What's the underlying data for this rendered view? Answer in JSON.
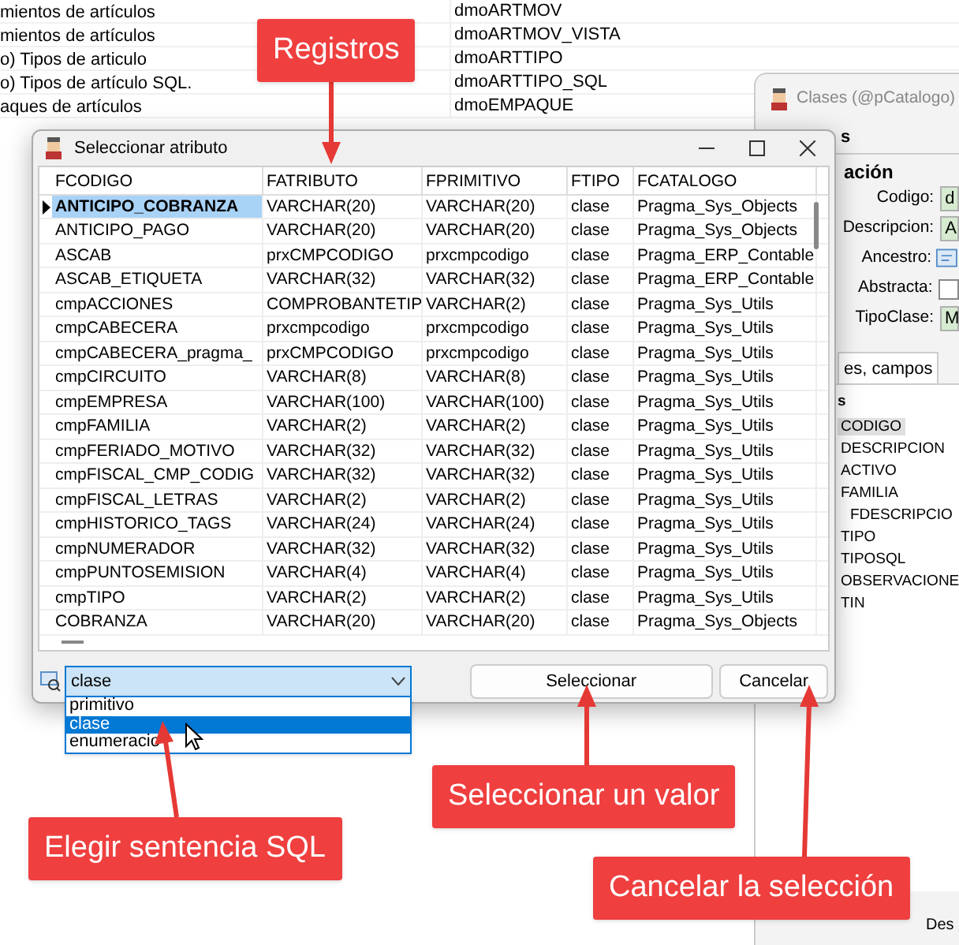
{
  "background_list": {
    "rows": [
      {
        "description": "mientos de artículos",
        "name": "dmoARTMOV"
      },
      {
        "description": "mientos de artículos",
        "name": "dmoARTMOV_VISTA"
      },
      {
        "description": "o) Tipos de articulo",
        "name": "dmoARTTIPO"
      },
      {
        "description": "o) Tipos de artículo SQL.",
        "name": "dmoARTTIPO_SQL"
      },
      {
        "description": "aques de artículos",
        "name": "dmoEMPAQUE"
      }
    ]
  },
  "clases_window": {
    "title": "Clases (@pCatalogo)",
    "header": "s",
    "section": "ación",
    "fields": [
      {
        "label": "Codigo:",
        "kind": "text",
        "value": "d"
      },
      {
        "label": "Descripcion:",
        "kind": "text",
        "value": "A"
      },
      {
        "label": "Ancestro:",
        "kind": "lookup"
      },
      {
        "label": "Abstracta:",
        "kind": "checkbox",
        "checked": false
      },
      {
        "label": "TipoClase:",
        "kind": "text",
        "value": "M"
      }
    ],
    "tab": "es, campos",
    "list_title": "s",
    "tree": [
      {
        "label": "CODIGO",
        "selected": true
      },
      {
        "label": "DESCRIPCION",
        "selected": false
      },
      {
        "label": "ACTIVO",
        "selected": false
      },
      {
        "label": "FAMILIA",
        "selected": false,
        "children": [
          {
            "label": "FDESCRIPCIO",
            "selected": false
          }
        ]
      },
      {
        "label": "TIPO",
        "selected": false
      },
      {
        "label": "TIPOSQL",
        "selected": false
      },
      {
        "label": "OBSERVACIONE",
        "selected": false
      },
      {
        "label": "TIN",
        "selected": false
      }
    ],
    "status": "Des"
  },
  "dialog": {
    "title": "Seleccionar atributo",
    "columns": [
      "FCODIGO",
      "FATRIBUTO",
      "FPRIMITIVO",
      "FTIPO",
      "FCATALOGO"
    ],
    "rows": [
      {
        "selected": true,
        "cells": [
          "ANTICIPO_COBRANZA",
          "VARCHAR(20)",
          "VARCHAR(20)",
          "clase",
          "Pragma_Sys_Objects"
        ]
      },
      {
        "selected": false,
        "cells": [
          "ANTICIPO_PAGO",
          "VARCHAR(20)",
          "VARCHAR(20)",
          "clase",
          "Pragma_Sys_Objects"
        ]
      },
      {
        "selected": false,
        "cells": [
          "ASCAB",
          "prxCMPCODIGO",
          "prxcmpcodigo",
          "clase",
          "Pragma_ERP_Contable"
        ]
      },
      {
        "selected": false,
        "cells": [
          "ASCAB_ETIQUETA",
          "VARCHAR(32)",
          "VARCHAR(32)",
          "clase",
          "Pragma_ERP_Contable"
        ]
      },
      {
        "selected": false,
        "cells": [
          "cmpACCIONES",
          "COMPROBANTETIP",
          "VARCHAR(2)",
          "clase",
          "Pragma_Sys_Utils"
        ]
      },
      {
        "selected": false,
        "cells": [
          "cmpCABECERA",
          "prxcmpcodigo",
          "prxcmpcodigo",
          "clase",
          "Pragma_Sys_Utils"
        ]
      },
      {
        "selected": false,
        "cells": [
          "cmpCABECERA_pragma_",
          "prxCMPCODIGO",
          "prxcmpcodigo",
          "clase",
          "Pragma_Sys_Utils"
        ]
      },
      {
        "selected": false,
        "cells": [
          "cmpCIRCUITO",
          "VARCHAR(8)",
          "VARCHAR(8)",
          "clase",
          "Pragma_Sys_Utils"
        ]
      },
      {
        "selected": false,
        "cells": [
          "cmpEMPRESA",
          "VARCHAR(100)",
          "VARCHAR(100)",
          "clase",
          "Pragma_Sys_Utils"
        ]
      },
      {
        "selected": false,
        "cells": [
          "cmpFAMILIA",
          "VARCHAR(2)",
          "VARCHAR(2)",
          "clase",
          "Pragma_Sys_Utils"
        ]
      },
      {
        "selected": false,
        "cells": [
          "cmpFERIADO_MOTIVO",
          "VARCHAR(32)",
          "VARCHAR(32)",
          "clase",
          "Pragma_Sys_Utils"
        ]
      },
      {
        "selected": false,
        "cells": [
          "cmpFISCAL_CMP_CODIG",
          "VARCHAR(32)",
          "VARCHAR(32)",
          "clase",
          "Pragma_Sys_Utils"
        ]
      },
      {
        "selected": false,
        "cells": [
          "cmpFISCAL_LETRAS",
          "VARCHAR(2)",
          "VARCHAR(2)",
          "clase",
          "Pragma_Sys_Utils"
        ]
      },
      {
        "selected": false,
        "cells": [
          "cmpHISTORICO_TAGS",
          "VARCHAR(24)",
          "VARCHAR(24)",
          "clase",
          "Pragma_Sys_Utils"
        ]
      },
      {
        "selected": false,
        "cells": [
          "cmpNUMERADOR",
          "VARCHAR(32)",
          "VARCHAR(32)",
          "clase",
          "Pragma_Sys_Utils"
        ]
      },
      {
        "selected": false,
        "cells": [
          "cmpPUNTOSEMISION",
          "VARCHAR(4)",
          "VARCHAR(4)",
          "clase",
          "Pragma_Sys_Utils"
        ]
      },
      {
        "selected": false,
        "cells": [
          "cmpTIPO",
          "VARCHAR(2)",
          "VARCHAR(2)",
          "clase",
          "Pragma_Sys_Utils"
        ]
      },
      {
        "selected": false,
        "cells": [
          "COBRANZA",
          "VARCHAR(20)",
          "VARCHAR(20)",
          "clase",
          "Pragma_Sys_Objects"
        ]
      }
    ],
    "combo": {
      "value": "clase",
      "options": [
        {
          "label": "primitivo",
          "selected": false
        },
        {
          "label": "clase",
          "selected": true
        },
        {
          "label": "enumeracio",
          "selected": false
        }
      ]
    },
    "buttons": [
      "Seleccionar",
      "Cancelar"
    ]
  },
  "callouts": [
    {
      "text": "Registros"
    },
    {
      "text": "Elegir sentencia SQL"
    },
    {
      "text": "Seleccionar un valor"
    },
    {
      "text": "Cancelar la selección"
    }
  ]
}
